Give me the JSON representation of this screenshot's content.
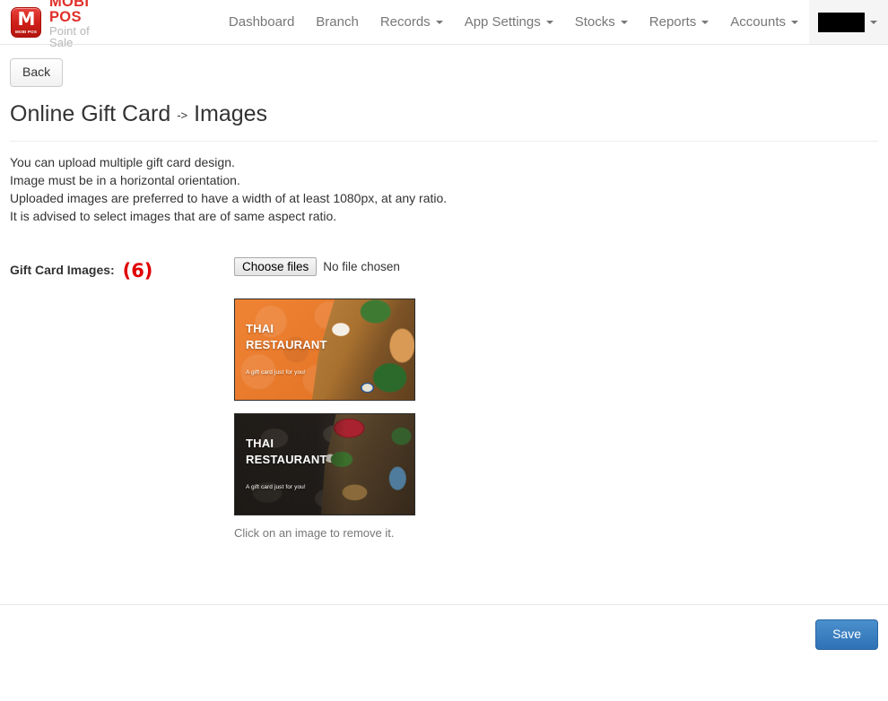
{
  "navbar": {
    "brand": {
      "badge_letter": "M",
      "badge_sub": "MOBI POS",
      "title": "MOBI POS",
      "subtitle": "Point of Sale"
    },
    "items": [
      {
        "label": "Dashboard",
        "caret": false
      },
      {
        "label": "Branch",
        "caret": false
      },
      {
        "label": "Records",
        "caret": true
      },
      {
        "label": "App Settings",
        "caret": true
      },
      {
        "label": "Stocks",
        "caret": true
      },
      {
        "label": "Reports",
        "caret": true
      },
      {
        "label": "Accounts",
        "caret": true
      }
    ],
    "account": {
      "label": "",
      "redacted": true,
      "caret": true
    }
  },
  "page": {
    "back_label": "Back",
    "title_main": "Online Gift Card",
    "title_arrow": "->",
    "title_sub": "Images",
    "notes": [
      "You can upload multiple gift card design.",
      "Image must be in a horizontal orientation.",
      "Uploaded images are preferred to have a width of at least 1080px, at any ratio.",
      "It is advised to select images that are of same aspect ratio."
    ]
  },
  "form": {
    "label": "Gift Card Images:",
    "annotation": "(6)",
    "annotation_color": "#e00000",
    "file_button_label": "Choose files",
    "file_status": "No file chosen",
    "thumbs_hint": "Click on an image to remove it.",
    "images": [
      {
        "title_line1": "THAI",
        "title_line2": "RESTAURANT",
        "subtitle": "A gift card just for you!",
        "theme": "orange",
        "background_color": "#e8772b"
      },
      {
        "title_line1": "THAI",
        "title_line2": "RESTAURANT",
        "subtitle": "A gift card just for you!",
        "theme": "dark",
        "background_color": "#2a2522"
      }
    ]
  },
  "footer": {
    "save_label": "Save",
    "save_color": "#3072b5"
  }
}
